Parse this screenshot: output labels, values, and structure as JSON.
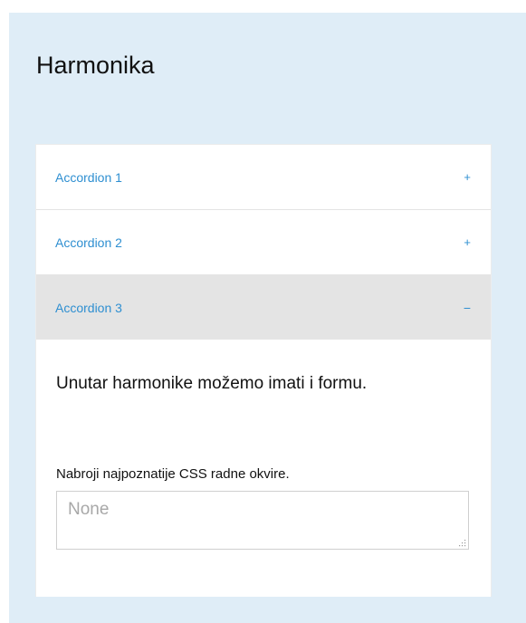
{
  "page": {
    "title": "Harmonika"
  },
  "accordion": {
    "items": [
      {
        "label": "Accordion 1",
        "sign": "+",
        "expanded": false
      },
      {
        "label": "Accordion 2",
        "sign": "+",
        "expanded": false
      },
      {
        "label": "Accordion 3",
        "sign": "−",
        "expanded": true
      }
    ],
    "panel": {
      "lead": "Unutar harmonike možemo imati i formu.",
      "field_label": "Nabroji najpoznatije CSS radne okvire.",
      "field_placeholder": "None",
      "field_value": ""
    }
  },
  "colors": {
    "background": "#dfedf7",
    "accent": "#2e8fd1",
    "active_header": "#e4e4e4"
  }
}
